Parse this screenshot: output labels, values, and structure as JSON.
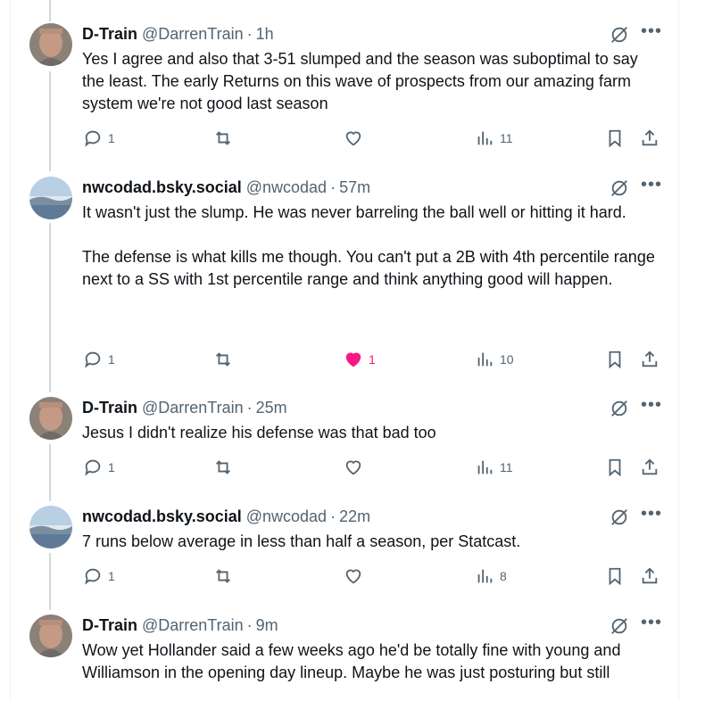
{
  "colors": {
    "accent": "#1d9bf0",
    "like": "#f91880",
    "muted": "#536471",
    "text": "#0f1419"
  },
  "posts": [
    {
      "name": "D-Train",
      "handle": "@DarrenTrain",
      "separator": "·",
      "time": "1h",
      "avatar": "man-face-avatar",
      "text": "Yes I agree and also that 3-51 slumped and the season was suboptimal to say the least. The early Returns on this wave of prospects from our amazing farm system we're not good last season",
      "replies": "1",
      "reposts": "",
      "likes": "",
      "views": "11",
      "liked": false
    },
    {
      "name": "nwcodad.bsky.social",
      "handle": "@nwcodad",
      "separator": "·",
      "time": "57m",
      "avatar": "landscape-lake-avatar",
      "text": "It wasn't just the slump. He was never barreling the ball well or hitting it hard.\n\nThe defense is what kills me though. You can't put a 2B with 4th percentile range next to a SS with 1st percentile range and think anything good will happen.",
      "replies": "1",
      "reposts": "",
      "likes": "1",
      "views": "10",
      "liked": true
    },
    {
      "name": "D-Train",
      "handle": "@DarrenTrain",
      "separator": "·",
      "time": "25m",
      "avatar": "man-face-avatar",
      "text": "Jesus I didn't realize his defense was that bad too",
      "replies": "1",
      "reposts": "",
      "likes": "",
      "views": "11",
      "liked": false
    },
    {
      "name": "nwcodad.bsky.social",
      "handle": "@nwcodad",
      "separator": "·",
      "time": "22m",
      "avatar": "landscape-lake-avatar",
      "text": "7 runs below average in less than half a season, per Statcast.",
      "replies": "1",
      "reposts": "",
      "likes": "",
      "views": "8",
      "liked": false
    },
    {
      "name": "D-Train",
      "handle": "@DarrenTrain",
      "separator": "·",
      "time": "9m",
      "avatar": "man-face-avatar",
      "text": "Wow yet Hollander said a few weeks ago he'd be totally fine with young and Williamson in the opening day lineup. Maybe he was just posturing but still",
      "replies": "",
      "reposts": "",
      "likes": "",
      "views": "",
      "liked": false
    }
  ]
}
